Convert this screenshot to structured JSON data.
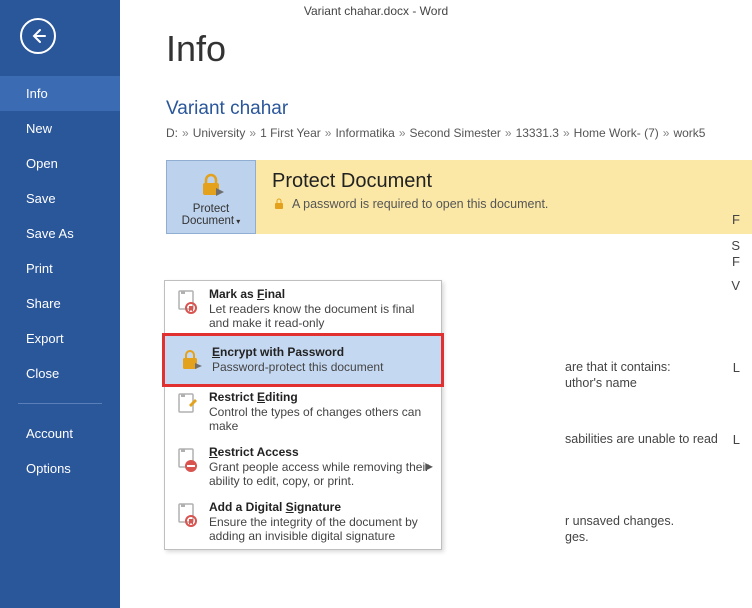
{
  "titlebar": "Variant chahar.docx - Word",
  "sidebar": {
    "items": [
      "Info",
      "New",
      "Open",
      "Save",
      "Save As",
      "Print",
      "Share",
      "Export",
      "Close"
    ],
    "bottom": [
      "Account",
      "Options"
    ]
  },
  "main": {
    "heading": "Info",
    "docname": "Variant chahar",
    "crumbs": [
      "D:",
      "University",
      "1 First Year",
      "Informatika",
      "Second Simester",
      "13331.3",
      "Home Work- (7)",
      "work5"
    ]
  },
  "protect": {
    "button_line1": "Protect",
    "button_line2": "Document",
    "title": "Protect Document",
    "subtitle": "A password is required to open this document."
  },
  "dropdown": [
    {
      "title_pre": "Mark as ",
      "title_u": "F",
      "title_post": "inal",
      "desc": "Let readers know the document is final and make it read-only",
      "icon": "ribbon"
    },
    {
      "title_pre": "",
      "title_u": "E",
      "title_post": "ncrypt with Password",
      "desc": "Password-protect this document",
      "icon": "lock",
      "highlight": true
    },
    {
      "title_pre": "Restrict ",
      "title_u": "E",
      "title_post": "diting",
      "desc": "Control the types of changes others can make",
      "icon": "pencil"
    },
    {
      "title_pre": "",
      "title_u": "R",
      "title_post": "estrict Access",
      "desc": "Grant people access while removing their ability to edit, copy, or print.",
      "icon": "block",
      "arrow": true
    },
    {
      "title_pre": "Add a Digital ",
      "title_u": "S",
      "title_post": "ignature",
      "desc": "Ensure the integrity of the document by adding an invisible digital signature",
      "icon": "ribbon"
    }
  ],
  "behind": {
    "a": "are that it contains:",
    "b": "uthor's name",
    "c": "sabilities are unable to read",
    "d": "r unsaved changes.",
    "e": "ges."
  },
  "right": [
    "F",
    "S",
    "F",
    "V",
    "L",
    "L"
  ]
}
